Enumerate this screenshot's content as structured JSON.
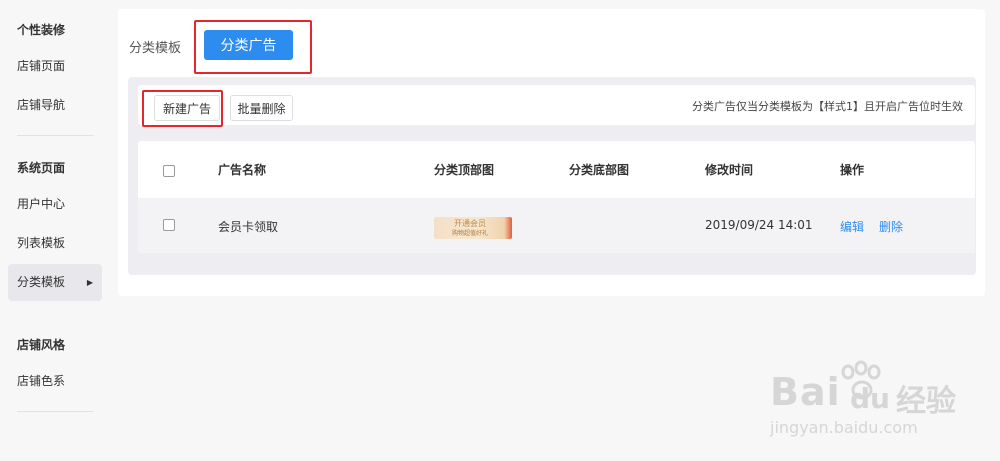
{
  "sidebar": {
    "groups": [
      {
        "title": "个性装修",
        "items": [
          "店铺页面",
          "店铺导航"
        ]
      },
      {
        "title": "系统页面",
        "items": [
          "用户中心",
          "列表模板",
          "分类模板"
        ]
      },
      {
        "title": "店铺风格",
        "items": [
          "店铺色系"
        ]
      }
    ],
    "active_item": "分类模板"
  },
  "header": {
    "tab_label": "分类模板",
    "active_tab_button": "分类广告"
  },
  "toolbar": {
    "new_button": "新建广告",
    "batch_delete_button": "批量删除",
    "notice": "分类广告仅当分类模板为【样式1】且开启广告位时生效"
  },
  "table": {
    "columns": [
      "广告名称",
      "分类顶部图",
      "分类底部图",
      "修改时间",
      "操作"
    ],
    "rows": [
      {
        "name": "会员卡领取",
        "top_image_text": "开通会员",
        "top_image_subtext": "购物超值好礼",
        "bottom_image": "",
        "modified": "2019/09/24 14:01",
        "actions": [
          "编辑",
          "删除"
        ]
      }
    ]
  },
  "watermark": {
    "brand": "Bai",
    "brand_tail": "du",
    "cn": "经验",
    "url": "jingyan.baidu.com"
  },
  "colors": {
    "accent": "#2d8cf0",
    "highlight_box": "#e6262f"
  }
}
